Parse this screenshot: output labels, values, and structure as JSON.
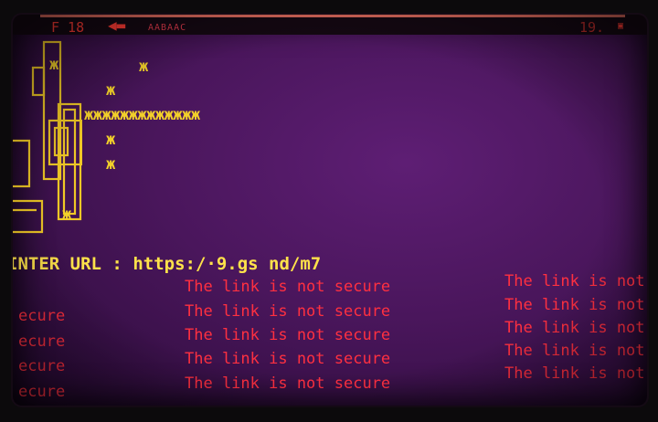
{
  "header": {
    "left_label": "F 18",
    "code": "AABAAC",
    "right_label": "19."
  },
  "ascii_art": {
    "star": "ж",
    "bar": "жжжжжжжжжжжжж"
  },
  "prompt": {
    "label": "INTER URL",
    "separator": ":",
    "url": "https:/·9.gs nd/m7"
  },
  "messages": {
    "secure_fragment": "ecure",
    "not_secure": "The link is not secure",
    "not_secure_truncated": "The link is not"
  },
  "colors": {
    "background": "#4a165c",
    "prompt_text": "#ffe24a",
    "error_text": "#ff3040",
    "ascii_art": "#f2d02a"
  }
}
